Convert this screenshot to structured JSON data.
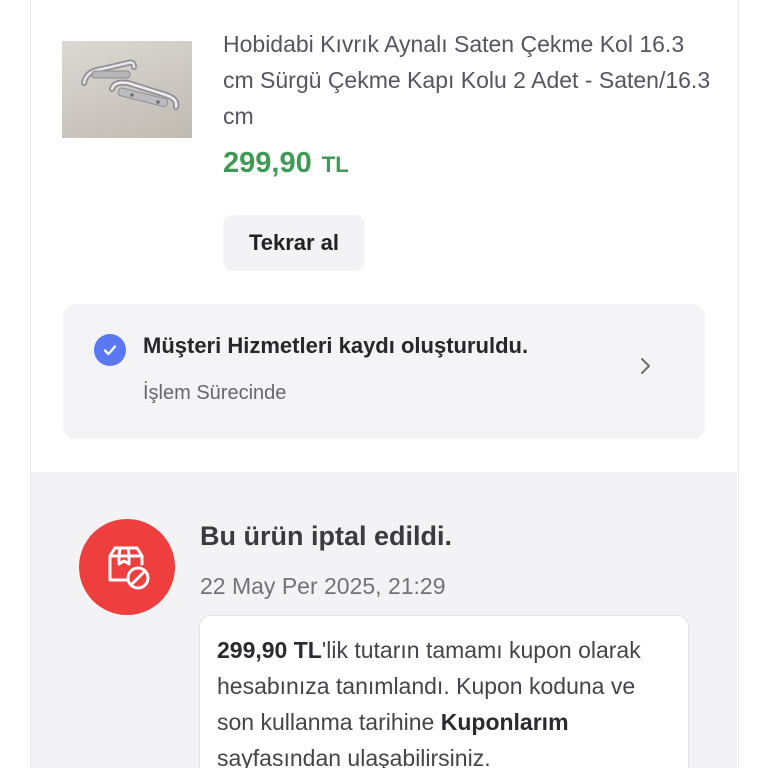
{
  "product": {
    "title": "Hobidabi Kıvrık Aynalı Saten Çekme Kol 16.3 cm Sürgü Çekme Kapı Kolu 2 Adet - Saten/16.3 cm",
    "price": "299,90",
    "currency": "TL",
    "image_icon": "door-handle-image"
  },
  "actions": {
    "reorder_label": "Tekrar al"
  },
  "service_record": {
    "title": "Müşteri Hizmetleri kaydı oluşturuldu.",
    "status": "İşlem Sürecinde",
    "icon": "check-circle-icon",
    "accent": "#5a78f2"
  },
  "cancellation": {
    "title": "Bu ürün iptal edildi.",
    "date": "22 May Per 2025, 21:29",
    "icon": "cancelled-package-icon",
    "accent": "#ee3e3e",
    "message": {
      "amount": "299,90 TL",
      "text_1": "'lik tutarın tamamı kupon olarak hesabınıza tanımlandı. Kupon koduna ve son kullanma tarihine ",
      "link": "Kuponlarım",
      "text_2": " sayfasından ulaşabilirsiniz."
    }
  },
  "colors": {
    "price_green": "#3e9a54",
    "background_gray": "#f3f3f5"
  }
}
